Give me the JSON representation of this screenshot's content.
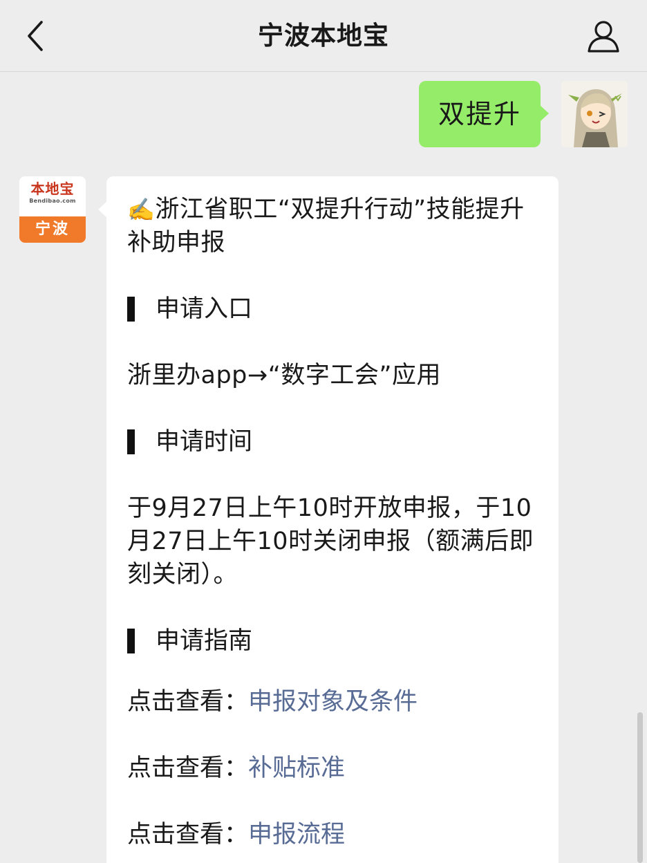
{
  "navbar": {
    "title": "宁波本地宝",
    "back_icon": "chevron-left-icon",
    "profile_icon": "user-profile-icon"
  },
  "outgoing_message": {
    "text": "双提升",
    "bubble_color": "#95ec69"
  },
  "bot": {
    "avatar": {
      "brand_name": "本地宝",
      "brand_url": "Bendibao.com",
      "city": "宁波",
      "accent_color": "#f0792a"
    }
  },
  "incoming_message": {
    "title_icon": "✍️",
    "title": "浙江省职工“双提升行动”技能提升补助申报",
    "sections": [
      {
        "heading": "申请入口",
        "body": "浙里办app→“数字工会”应用"
      },
      {
        "heading": "申请时间",
        "body": "于9月27日上午10时开放申报，于10月27日上午10时关闭申报（额满后即刻关闭）。"
      },
      {
        "heading": "申请指南"
      }
    ],
    "links": [
      {
        "prefix": "点击查看：",
        "label": "申报对象及条件"
      },
      {
        "prefix": "点击查看：",
        "label": "补贴标准"
      },
      {
        "prefix": "点击查看：",
        "label": "申报流程"
      }
    ],
    "link_color": "#576b95"
  }
}
